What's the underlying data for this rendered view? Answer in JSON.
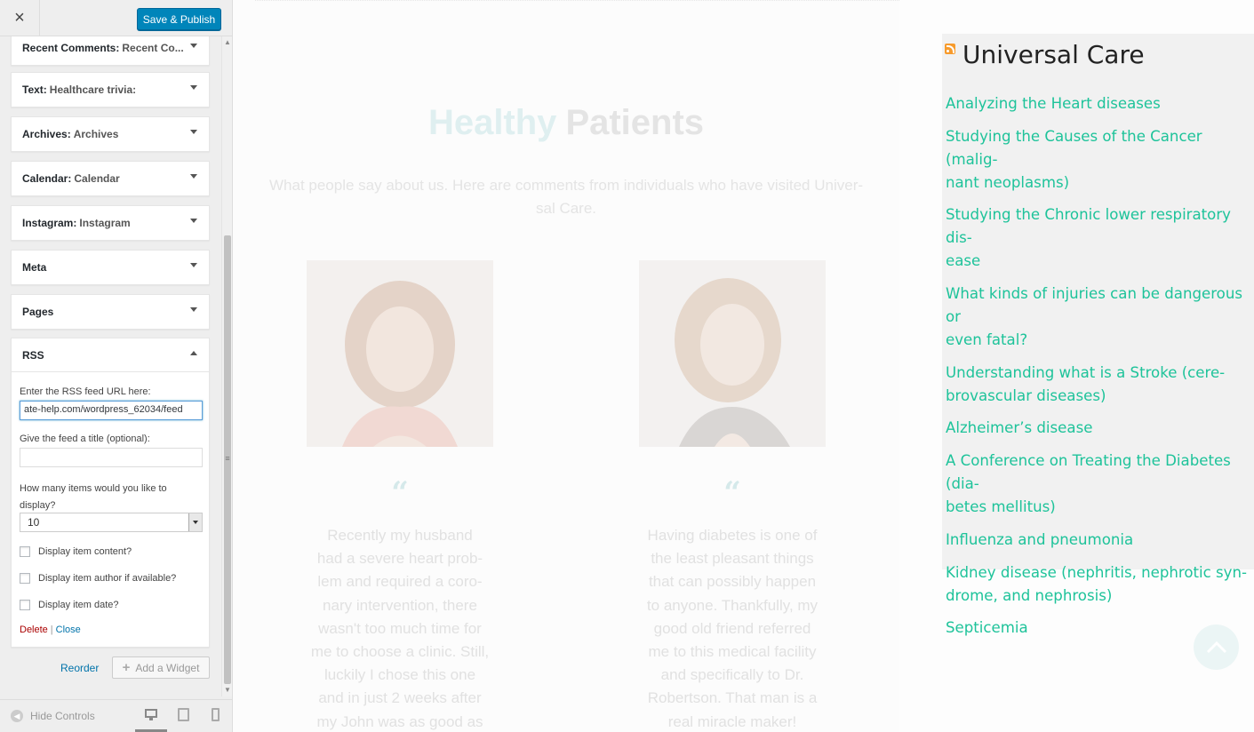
{
  "customizer": {
    "save_label": "Save & Publish",
    "close_glyph": "×",
    "widgets": [
      {
        "type": "Recent Comments",
        "title": "Recent Co..."
      },
      {
        "type": "Text",
        "title": "Healthcare trivia:"
      },
      {
        "type": "Archives",
        "title": "Archives"
      },
      {
        "type": "Calendar",
        "title": "Calendar"
      },
      {
        "type": "Instagram",
        "title": "Instagram"
      },
      {
        "type": "Meta",
        "title": ""
      },
      {
        "type": "Pages",
        "title": ""
      }
    ],
    "rss": {
      "type": "RSS",
      "url_label": "Enter the RSS feed URL here:",
      "url_value": "ate-help.com/wordpress_62034/feed",
      "title_label": "Give the feed a title (optional):",
      "title_value": "",
      "items_label_1": "How many items would you like to",
      "items_label_2": "display?",
      "items_value": "10",
      "opt_content": "Display item content?",
      "opt_author": "Display item author if available?",
      "opt_date": "Display item date?",
      "delete_label": "Delete",
      "separator": "|",
      "close_label": "Close"
    },
    "reorder_label": "Reorder",
    "add_widget_label": "Add a Widget",
    "hide_controls_label": "Hide Controls"
  },
  "preview": {
    "title_highlight": "Healthy",
    "title_rest": "Patients",
    "subtitle_1": "What people say about us. Here are comments from individuals who have visited Univer-",
    "subtitle_2": "sal Care.",
    "testimonials": [
      {
        "lines": [
          "Recently my husband",
          "had a severe heart prob-",
          "lem and required a coro-",
          "nary intervention, there",
          "wasn't too much time for",
          "me to choose a clinic. Still,",
          "luckily I chose this one",
          "and in just 2 weeks after",
          "my John was as good as"
        ]
      },
      {
        "lines": [
          "Having diabetes is one of",
          "the least pleasant things",
          "that can possibly happen",
          "to anyone. Thankfully, my",
          "good old friend referred",
          "me to this medical facility",
          "and specifically to Dr.",
          "Robertson. That man is a",
          "real miracle maker!"
        ]
      }
    ],
    "quote_glyph": "“",
    "rss_widget": {
      "title": "Universal Care",
      "items": [
        "Analyzing the Heart diseases",
        "Studying the Causes of the Cancer (malig-\nnant neoplasms)",
        "Studying the Chronic lower respiratory dis-\nease",
        "What kinds of injuries can be dangerous or\neven fatal?",
        "Understanding what is a Stroke (cere-\nbrovascular diseases)",
        "Alzheimer’s disease",
        "A Conference on Treating the Diabetes (dia-\nbetes mellitus)",
        "Influenza and pneumonia",
        "Kidney disease (nephritis, nephrotic syn-\ndrome, and nephrosis)",
        "Septicemia"
      ]
    }
  },
  "colors": {
    "accent": "#0085ba",
    "link": "#1ec39a",
    "delete": "#a00000"
  }
}
